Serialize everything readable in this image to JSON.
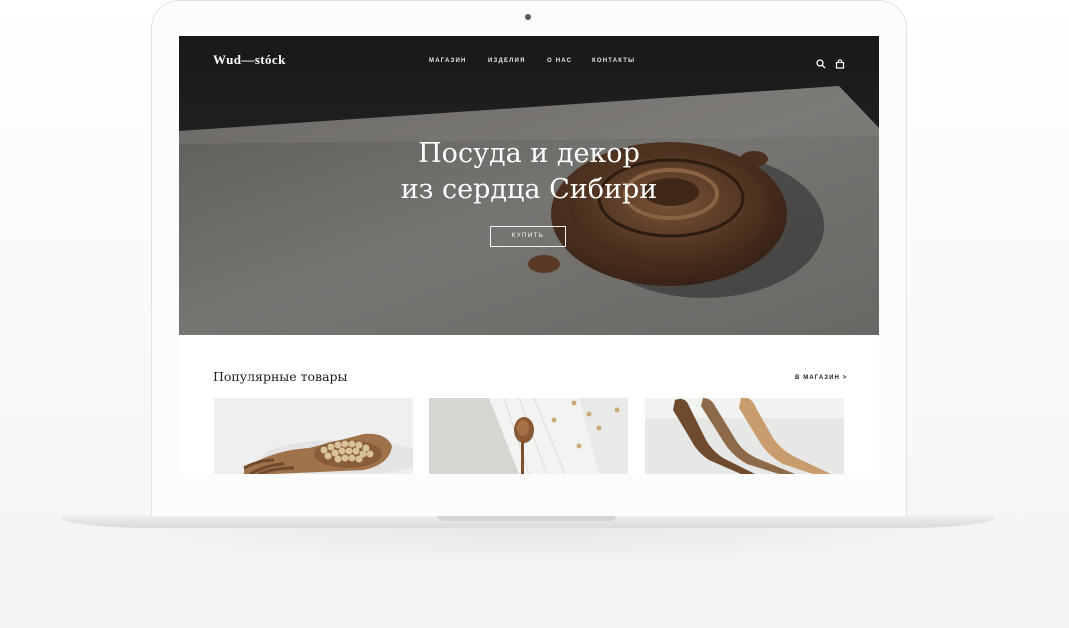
{
  "site": {
    "logo": "Wud—stóck",
    "nav": [
      "магазин",
      "изделия",
      "о нас",
      "контакты"
    ],
    "header_icons": [
      "search-icon",
      "shopping-bag-icon"
    ]
  },
  "hero": {
    "title_line1": "Посуда и декор",
    "title_line2": "из сердца Сибири",
    "button_label": "купить"
  },
  "popular": {
    "title": "Популярные товары",
    "shop_link": "в магазин >",
    "products": [
      {
        "image": "wooden-hand-scoop-with-chickpeas"
      },
      {
        "image": "wooden-spoon-on-linen"
      },
      {
        "image": "wooden-knives"
      }
    ]
  },
  "colors": {
    "hero_dark": "#1b1b1b",
    "linen_gray": "#6f6d6a",
    "wood_brown": "#5a3a24",
    "page_bg": "#ffffff",
    "text_dark": "#1e1e1e"
  }
}
